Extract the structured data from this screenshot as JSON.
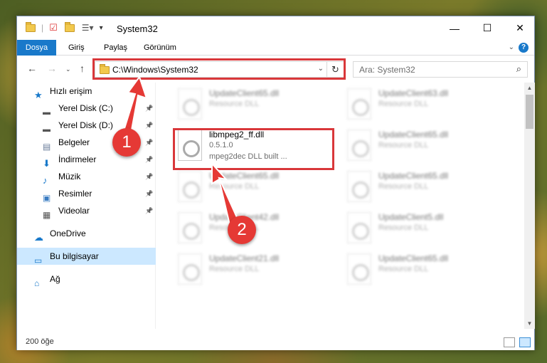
{
  "window": {
    "title": "System32",
    "controls": {
      "minimize": "—",
      "maximize": "☐",
      "close": "✕"
    }
  },
  "ribbon": {
    "tabs": [
      "Dosya",
      "Giriş",
      "Paylaş",
      "Görünüm"
    ],
    "help": "?"
  },
  "address": {
    "path": "C:\\Windows\\System32",
    "search_placeholder": "Ara: System32"
  },
  "sidebar": {
    "items": [
      {
        "label": "Hızlı erişim",
        "icon": "star-icon",
        "pinned": false
      },
      {
        "label": "Yerel Disk (C:)",
        "icon": "drive-icon",
        "pinned": true
      },
      {
        "label": "Yerel Disk (D:)",
        "icon": "drive-icon",
        "pinned": true
      },
      {
        "label": "Belgeler",
        "icon": "document-icon",
        "pinned": true
      },
      {
        "label": "İndirmeler",
        "icon": "download-icon",
        "pinned": true
      },
      {
        "label": "Müzik",
        "icon": "music-icon",
        "pinned": true
      },
      {
        "label": "Resimler",
        "icon": "picture-icon",
        "pinned": true
      },
      {
        "label": "Videolar",
        "icon": "video-icon",
        "pinned": true
      },
      {
        "label": "OneDrive",
        "icon": "cloud-icon",
        "pinned": false
      },
      {
        "label": "Bu bilgisayar",
        "icon": "computer-icon",
        "pinned": false,
        "selected": true
      },
      {
        "label": "Ağ",
        "icon": "network-icon",
        "pinned": false
      }
    ]
  },
  "files": [
    {
      "name": "UpdateClient65.dll",
      "version": "",
      "desc": "Resource DLL",
      "blurred": true
    },
    {
      "name": "UpdateClient63.dll",
      "version": "",
      "desc": "Resource DLL",
      "blurred": true
    },
    {
      "name": "libmpeg2_ff.dll",
      "version": "0.5.1.0",
      "desc": "mpeg2dec DLL built ...",
      "blurred": false
    },
    {
      "name": "UpdateClient65.dll",
      "version": "",
      "desc": "Resource DLL",
      "blurred": true
    },
    {
      "name": "UpdateClient65.dll",
      "version": "",
      "desc": "Resource DLL",
      "blurred": true
    },
    {
      "name": "UpdateClient65.dll",
      "version": "",
      "desc": "Resource DLL",
      "blurred": true
    },
    {
      "name": "UpdateClient42.dll",
      "version": "",
      "desc": "Resource DLL",
      "blurred": true
    },
    {
      "name": "UpdateClient5.dll",
      "version": "",
      "desc": "Resource DLL",
      "blurred": true
    },
    {
      "name": "UpdateClient21.dll",
      "version": "",
      "desc": "Resource DLL",
      "blurred": true
    },
    {
      "name": "UpdateClient65.dll",
      "version": "",
      "desc": "Resource DLL",
      "blurred": true
    }
  ],
  "status": {
    "count": "200 öğe"
  },
  "annotations": {
    "badge1": "1",
    "badge2": "2",
    "color": "#d9373a"
  },
  "colors": {
    "accent": "#1979ca",
    "selected": "#cce8ff"
  }
}
